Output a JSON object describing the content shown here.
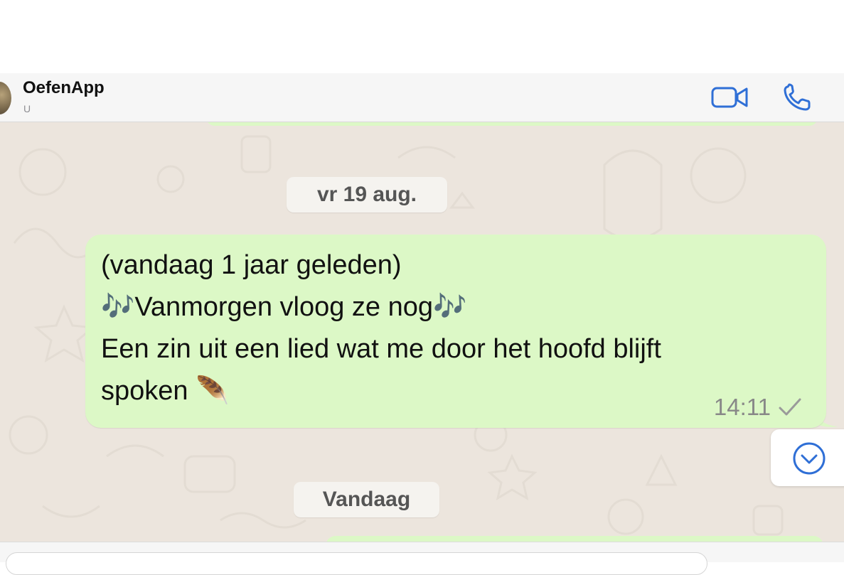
{
  "header": {
    "contact_name": "OefenApp",
    "contact_subtitle": "U",
    "video_call_icon": "video-camera-icon",
    "voice_call_icon": "phone-icon",
    "accent_color": "#2f6fd6"
  },
  "chat": {
    "date_chip_1": "vr 19 aug.",
    "message": {
      "lines": [
        "(vandaag 1 jaar geleden)",
        "🎶Vanmorgen vloog ze nog🎶",
        "Een zin uit een lied wat me door het hoofd blijft",
        "spoken 🪶"
      ],
      "time": "14:11",
      "status_icon": "single-check-icon"
    },
    "date_chip_2": "Vandaag",
    "scroll_down_icon": "chevron-down-circle-icon",
    "bubble_color": "#dcf8c6"
  }
}
